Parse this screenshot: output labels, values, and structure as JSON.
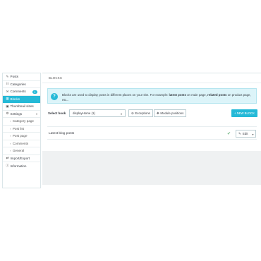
{
  "sidebar": {
    "items": [
      {
        "icon": "pencil-icon",
        "glyph": "✎",
        "label": "Posts"
      },
      {
        "icon": "sitemap-icon",
        "glyph": "☷",
        "label": "Categories"
      },
      {
        "icon": "comments-icon",
        "glyph": "✉",
        "label": "Comments",
        "badge": "1"
      },
      {
        "icon": "blocks-icon",
        "glyph": "▦",
        "label": "Blocks"
      },
      {
        "icon": "image-icon",
        "glyph": "▣",
        "label": "Thumbnail sizes"
      },
      {
        "icon": "gear-icon",
        "glyph": "⚙",
        "label": "Settings",
        "expand": "▾"
      },
      {
        "label": "Category page"
      },
      {
        "label": "Post list"
      },
      {
        "label": "Post page"
      },
      {
        "label": "Comments"
      },
      {
        "label": "General"
      },
      {
        "icon": "exchange-icon",
        "glyph": "⇄",
        "label": "Import/Export"
      },
      {
        "icon": "info-icon",
        "glyph": "ⓘ",
        "label": "Information"
      }
    ]
  },
  "panel": {
    "title": "BLOCKS"
  },
  "alert": {
    "icon": "?",
    "text_1": "Blocks are used to display posts in different places on your site. For example: ",
    "bold_1": "latest posts",
    "text_2": " on main page, ",
    "bold_2": "related posts",
    "text_3": " on product page, etc..."
  },
  "toolbar": {
    "hook_label": "Select hook",
    "hook_value": "displayHome (1)",
    "exceptions_label": "Exceptions",
    "module_positions_label": "Module positions",
    "new_block_label": "+ NEW BLOCK"
  },
  "blocks": [
    {
      "title": "Latest blog posts",
      "status": "✔",
      "edit_label": "Edit"
    }
  ],
  "colors": {
    "accent": "#25b9d7",
    "alert_bg": "#dcf4f9",
    "check": "#70b580"
  }
}
